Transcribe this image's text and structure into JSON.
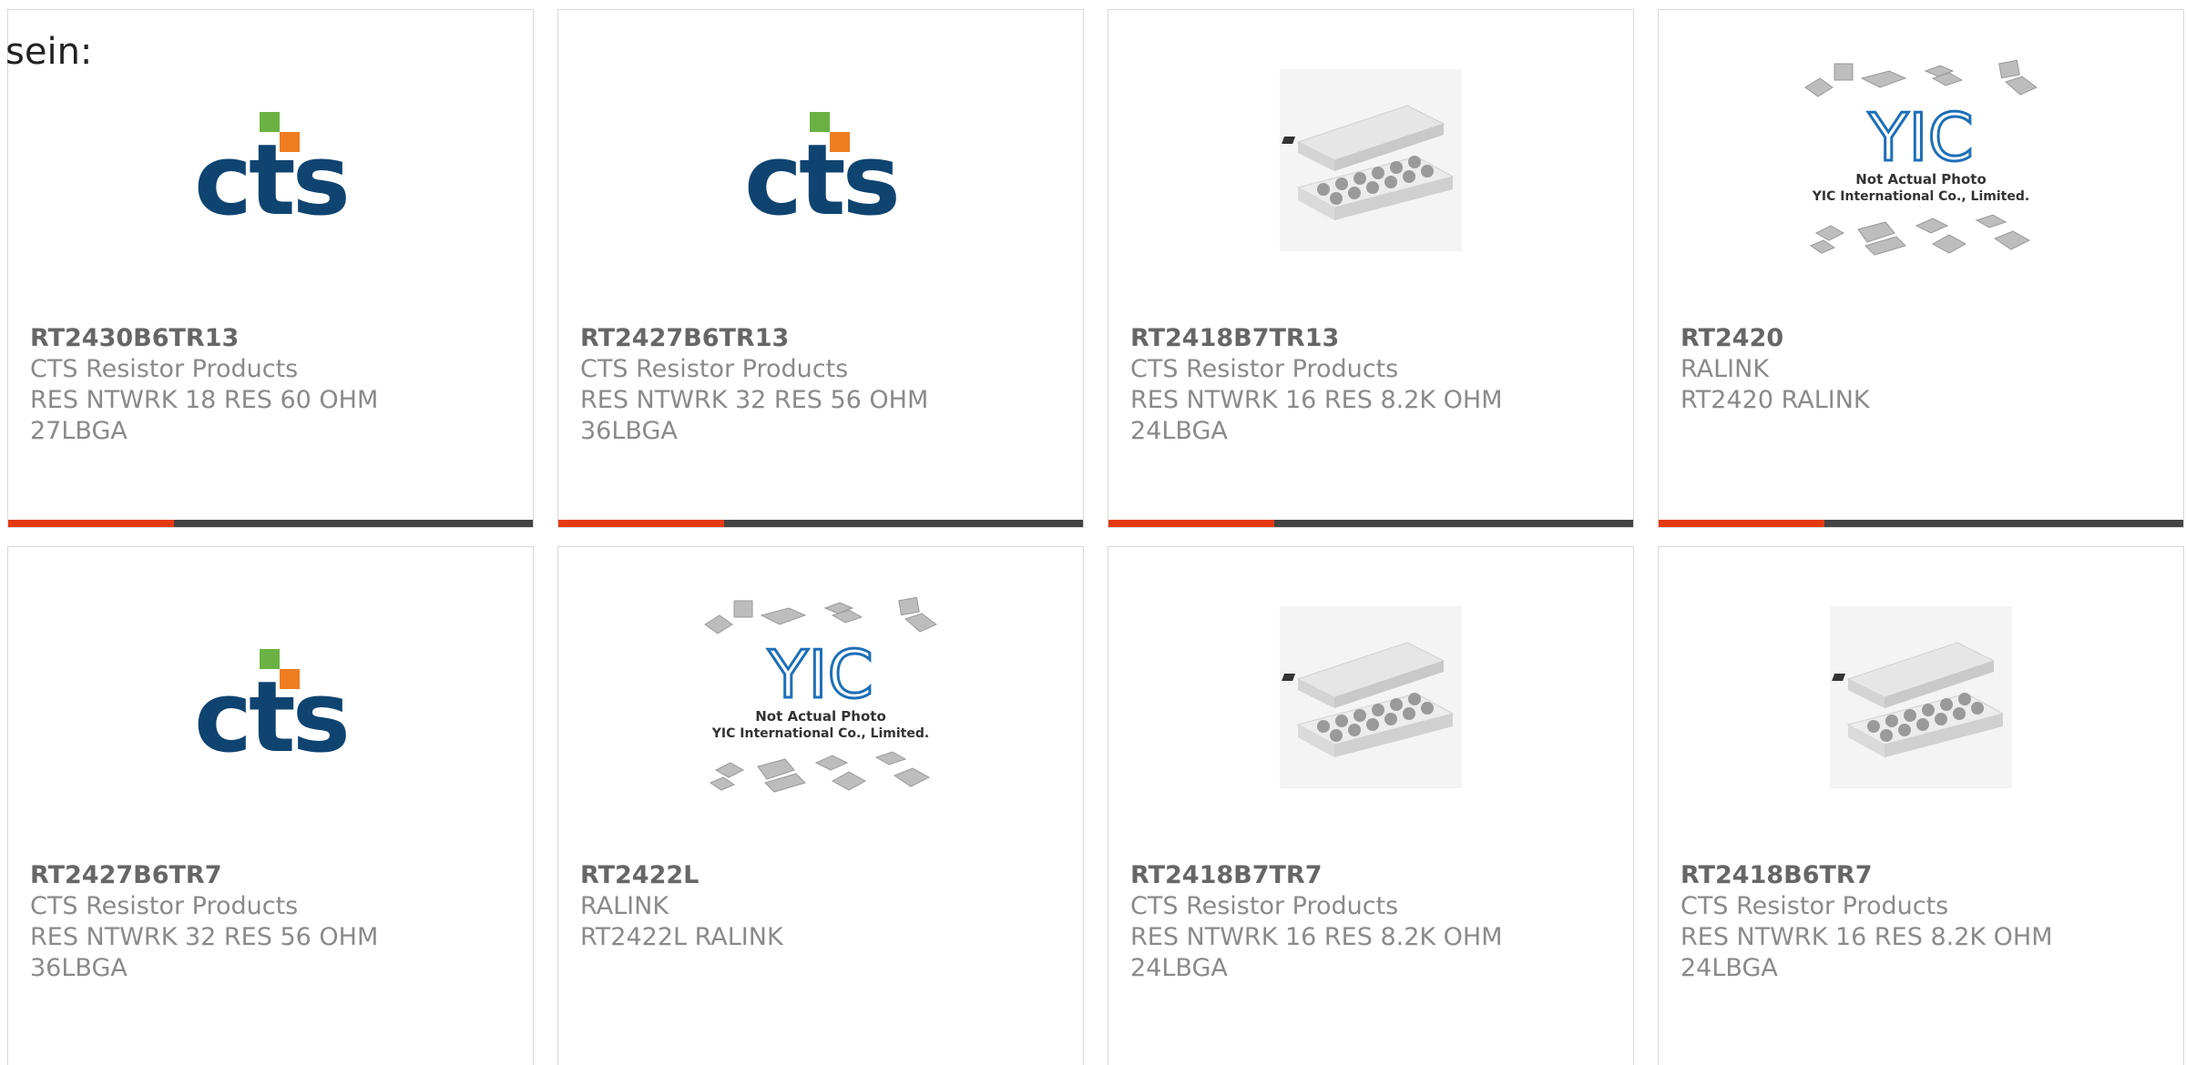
{
  "prefix_text": "sein:",
  "colors": {
    "accent": "#e53a10",
    "bar_dark": "#444444",
    "cts_blue": "#0f4471",
    "cts_orange": "#ef7d22",
    "cts_green": "#6bb244",
    "yic_blue": "#1d6fb8"
  },
  "rows": [
    [
      {
        "part_number": "RT2430B6TR13",
        "manufacturer": "CTS Resistor Products",
        "line1": "RES NTWRK 18 RES 60 OHM",
        "line2": "27LBGA",
        "image": "cts-logo"
      },
      {
        "part_number": "RT2427B6TR13",
        "manufacturer": "CTS Resistor Products",
        "line1": "RES NTWRK 32 RES 56 OHM",
        "line2": "36LBGA",
        "image": "cts-logo"
      },
      {
        "part_number": "RT2418B7TR13",
        "manufacturer": "CTS Resistor Products",
        "line1": "RES NTWRK 16 RES 8.2K OHM",
        "line2": "24LBGA",
        "image": "bga-package"
      },
      {
        "part_number": "RT2420",
        "manufacturer": "RALINK",
        "line1": "RT2420 RALINK",
        "line2": "",
        "image": "yic-placeholder"
      }
    ],
    [
      {
        "part_number": "RT2427B6TR7",
        "manufacturer": "CTS Resistor Products",
        "line1": "RES NTWRK 32 RES 56 OHM",
        "line2": "36LBGA",
        "image": "cts-logo"
      },
      {
        "part_number": "RT2422L",
        "manufacturer": "RALINK",
        "line1": "RT2422L RALINK",
        "line2": "",
        "image": "yic-placeholder"
      },
      {
        "part_number": "RT2418B7TR7",
        "manufacturer": "CTS Resistor Products",
        "line1": "RES NTWRK 16 RES 8.2K OHM",
        "line2": "24LBGA",
        "image": "bga-package"
      },
      {
        "part_number": "RT2418B6TR7",
        "manufacturer": "CTS Resistor Products",
        "line1": "RES NTWRK 16 RES 8.2K OHM",
        "line2": "24LBGA",
        "image": "bga-package"
      }
    ]
  ],
  "logos": {
    "cts": "cts",
    "yic": "YIC",
    "yic_line1": "Not Actual Photo",
    "yic_line2": "YIC International Co., Limited."
  }
}
